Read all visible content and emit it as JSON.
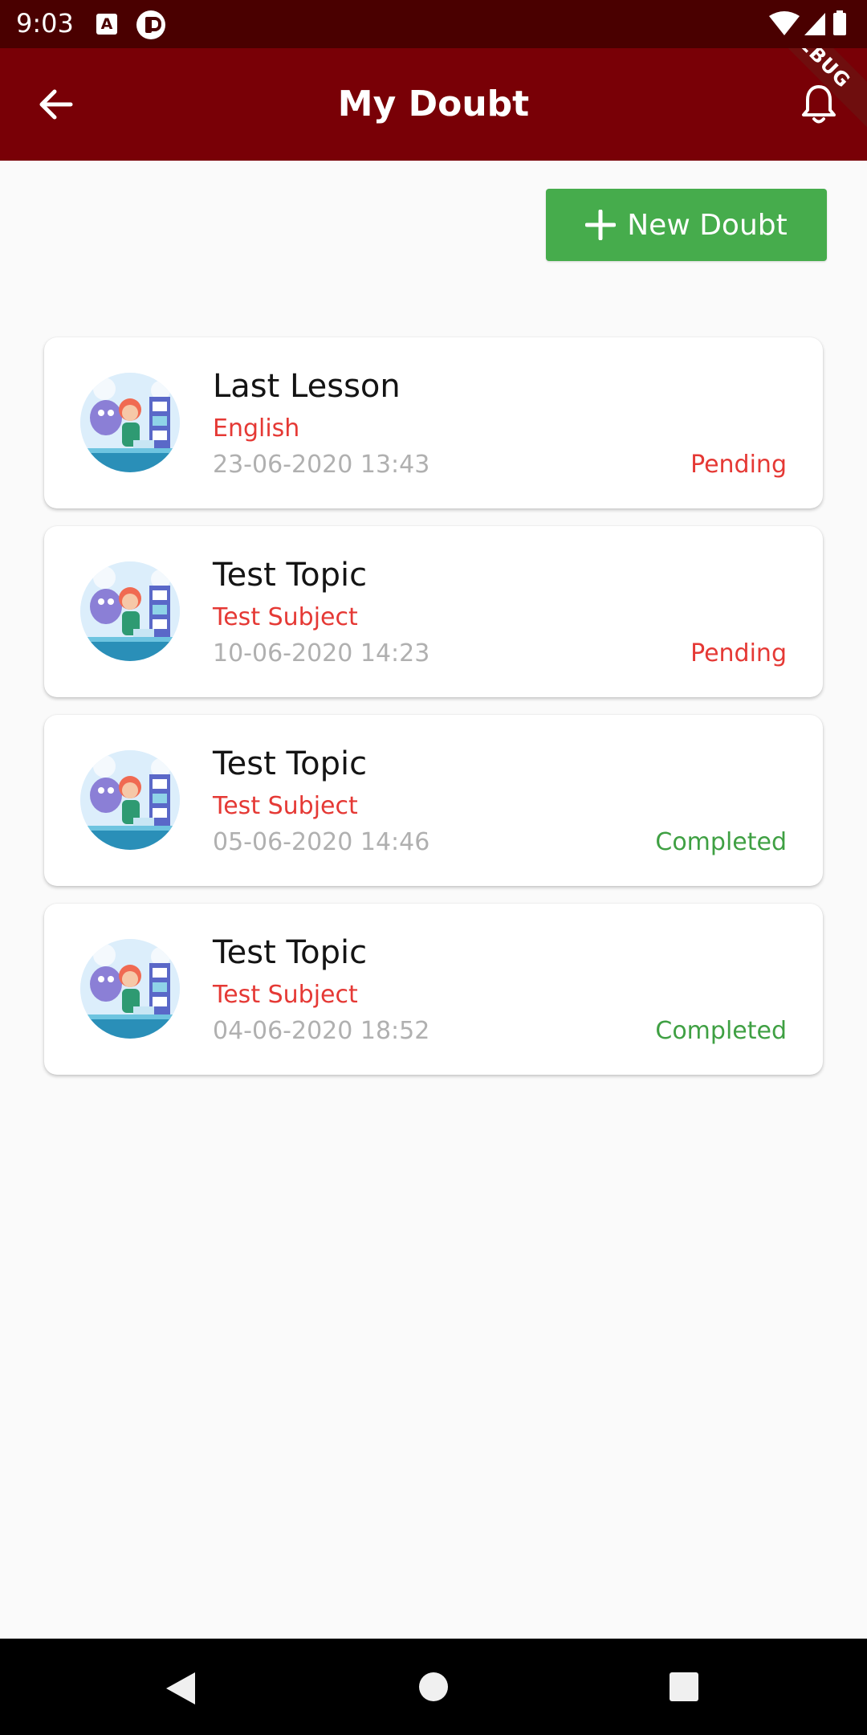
{
  "status_bar": {
    "time": "9:03",
    "a_icon_letter": "A",
    "icons": [
      "a-notification-icon",
      "p-notification-icon",
      "wifi-icon",
      "signal-icon",
      "battery-icon"
    ]
  },
  "header": {
    "title": "My Doubt",
    "debug_label": "DEBUG",
    "color": "#790006",
    "icons": [
      "back-arrow-icon",
      "bell-icon"
    ]
  },
  "actions": {
    "new_doubt_label": "New Doubt",
    "new_doubt_color": "#46ac4c"
  },
  "doubts": [
    {
      "topic": "Last Lesson",
      "subject": "English",
      "date": "23-06-2020 13:43",
      "status": "Pending",
      "status_color": "#e53935"
    },
    {
      "topic": "Test Topic",
      "subject": "Test Subject",
      "date": "10-06-2020 14:23",
      "status": "Pending",
      "status_color": "#e53935"
    },
    {
      "topic": "Test Topic",
      "subject": "Test Subject",
      "date": "05-06-2020 14:46",
      "status": "Completed",
      "status_color": "#3fa043"
    },
    {
      "topic": "Test Topic",
      "subject": "Test Subject",
      "date": "04-06-2020 18:52",
      "status": "Completed",
      "status_color": "#3fa043"
    }
  ],
  "nav_bar": {
    "icons": [
      "nav-back-icon",
      "nav-home-icon",
      "nav-recents-icon"
    ]
  }
}
